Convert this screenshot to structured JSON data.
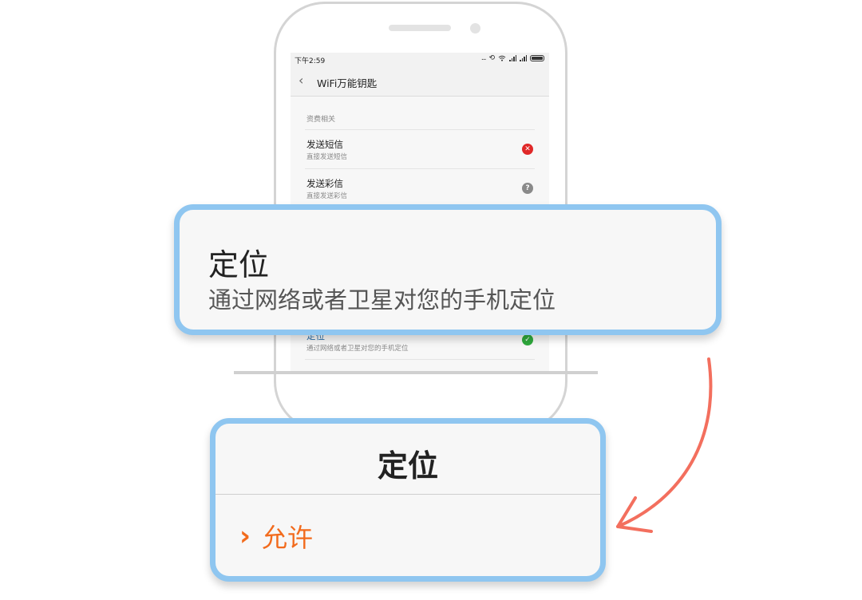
{
  "status_bar": {
    "time": "下午2:59",
    "dots": "...",
    "sync_icon": "sync-icon",
    "wifi_icon": "wifi-icon"
  },
  "app_bar": {
    "back_icon": "‹",
    "title": "WiFi万能钥匙"
  },
  "permissions": {
    "section_label": "资费相关",
    "items": [
      {
        "title": "发送短信",
        "subtitle": "直接发送短信",
        "status": "deny",
        "status_glyph": "✕"
      },
      {
        "title": "发送彩信",
        "subtitle": "直接发送彩信",
        "status": "ask",
        "status_glyph": "?"
      },
      {
        "title": "定位",
        "subtitle": "通过网络或者卫星对您的手机定位",
        "status": "allow",
        "status_glyph": "✓"
      }
    ]
  },
  "zoom_callout": {
    "title": "定位",
    "subtitle": "通过网络或者卫星对您的手机定位"
  },
  "dialog": {
    "title": "定位",
    "option_icon": "›",
    "option_label": "允许"
  },
  "colors": {
    "accent_blue": "#8fc6f0",
    "option_orange": "#f26b1d",
    "arrow_red": "#f36f5e",
    "deny": "#e02828",
    "allow": "#2faa3d",
    "ask": "#8a8a8a"
  }
}
